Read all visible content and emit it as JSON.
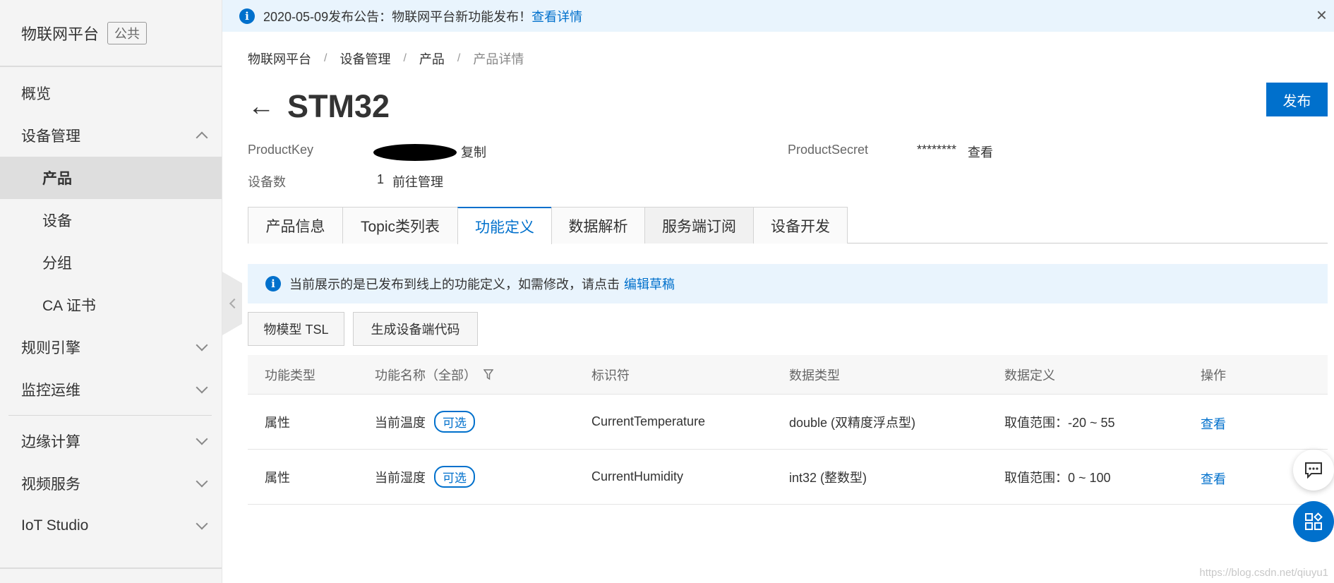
{
  "sidebar": {
    "brand_title": "物联网平台",
    "brand_badge": "公共",
    "items": [
      {
        "label": "概览"
      },
      {
        "label": "设备管理"
      },
      {
        "label": "产品"
      },
      {
        "label": "设备"
      },
      {
        "label": "分组"
      },
      {
        "label": "CA 证书"
      },
      {
        "label": "规则引擎"
      },
      {
        "label": "监控运维"
      },
      {
        "label": "边缘计算"
      },
      {
        "label": "视频服务"
      },
      {
        "label": "IoT Studio"
      }
    ]
  },
  "announcement": {
    "text": "2020-05-09发布公告：物联网平台新功能发布！",
    "link": "查看详情",
    "close": "×"
  },
  "breadcrumb": [
    "物联网平台",
    "设备管理",
    "产品",
    "产品详情"
  ],
  "breadcrumb_sep": "/",
  "header": {
    "back": "←",
    "title": "STM32",
    "publish": "发布"
  },
  "meta": {
    "product_key_label": "ProductKey",
    "copy": "复制",
    "product_secret_label": "ProductSecret",
    "product_secret_value": "********",
    "view": "查看",
    "device_count_label": "设备数",
    "device_count": "1",
    "manage": "前往管理"
  },
  "tabs": [
    {
      "label": "产品信息"
    },
    {
      "label": "Topic类列表"
    },
    {
      "label": "功能定义"
    },
    {
      "label": "数据解析"
    },
    {
      "label": "服务端订阅"
    },
    {
      "label": "设备开发"
    }
  ],
  "notice": {
    "text": "当前展示的是已发布到线上的功能定义，如需修改，请点击",
    "link": "编辑草稿"
  },
  "buttons": {
    "tsl": "物模型 TSL",
    "gen_code": "生成设备端代码"
  },
  "table": {
    "headers": [
      "功能类型",
      "功能名称（全部）",
      "标识符",
      "数据类型",
      "数据定义",
      "操作"
    ],
    "rows": [
      {
        "type": "属性",
        "name": "当前温度",
        "tag": "可选",
        "identifier": "CurrentTemperature",
        "data_type": "double (双精度浮点型)",
        "definition": "取值范围：-20 ~ 55",
        "action": "查看"
      },
      {
        "type": "属性",
        "name": "当前湿度",
        "tag": "可选",
        "identifier": "CurrentHumidity",
        "data_type": "int32 (整数型)",
        "definition": "取值范围：0 ~ 100",
        "action": "查看"
      }
    ]
  },
  "watermark": "https://blog.csdn.net/qiuyu1",
  "colors": {
    "accent": "#0070cc",
    "notice_bg": "#e9f4fd",
    "sidebar_bg": "#f4f4f4"
  },
  "icons": [
    "info-icon",
    "close-icon",
    "back-arrow-icon",
    "chevron-up-icon",
    "chevron-down-icon",
    "filter-icon",
    "chat-icon",
    "apps-icon"
  ]
}
